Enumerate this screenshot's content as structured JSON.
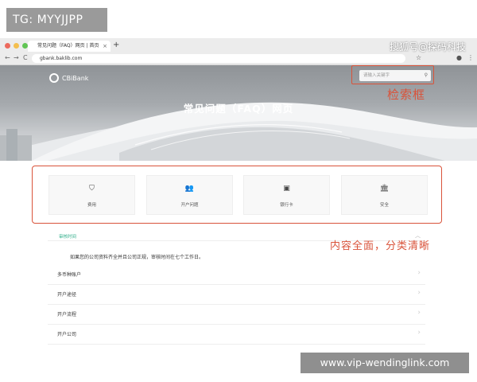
{
  "overlay": {
    "tg_tag": "TG: MYYJJPP",
    "watermark_top": "搜狐号@探码科技",
    "url_overlay": "www.vip-wendinglink.com"
  },
  "browser": {
    "tab_title": "常见问题（FAQ）网页 | 首页",
    "new_tab": "+",
    "tab_close": "×",
    "address": "gbank.baklib.com",
    "back": "←",
    "forward": "→",
    "reload": "C",
    "lock": "🔒",
    "star": "☆",
    "menu": "⋮",
    "profile": "●"
  },
  "site": {
    "logo_text": "CBiBank",
    "search_placeholder": "请输入关键字",
    "search_icon": "⚲",
    "hero_title": "常见问题（FAQ）网页"
  },
  "annotations": {
    "search": "检索框",
    "categories": "内容全面，分类清晰"
  },
  "categories": [
    {
      "icon": "tag-icon",
      "glyph": "⛉",
      "label": "费用"
    },
    {
      "icon": "users-icon",
      "glyph": "👥",
      "label": "开户问题"
    },
    {
      "icon": "card-icon",
      "glyph": "▣",
      "label": "银行卡"
    },
    {
      "icon": "bank-icon",
      "glyph": "🏛",
      "label": "安全"
    }
  ],
  "content": {
    "section_title": "审核时间",
    "section_text": "如果您的公司资料齐全并且公司正规，审核时间在七个工作日。",
    "chevron_up": "︿",
    "rows": [
      {
        "label": "多币种账户",
        "chevron": "›"
      },
      {
        "label": "开户途径",
        "chevron": "›"
      },
      {
        "label": "开户流程",
        "chevron": "›"
      },
      {
        "label": "开户公司",
        "chevron": "›"
      }
    ]
  },
  "colors": {
    "accent_red": "#d9533a",
    "teal": "#2fae8a"
  }
}
